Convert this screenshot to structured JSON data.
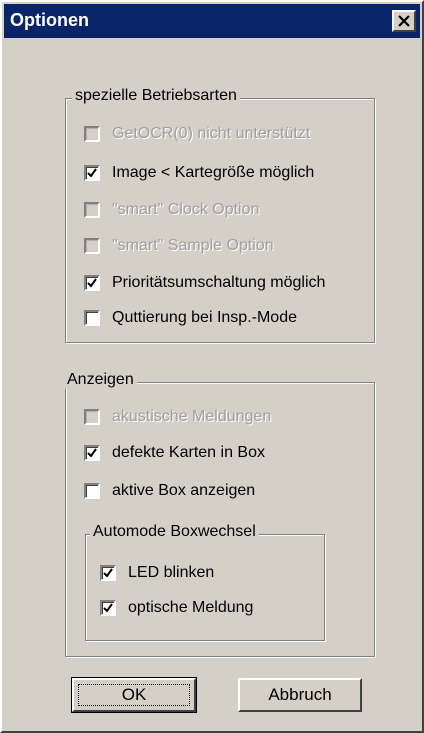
{
  "window": {
    "title": "Optionen",
    "close_label": "×"
  },
  "group_betrieb": {
    "label": "spezielle Betriebsarten",
    "items": [
      {
        "label": "GetOCR(0) nicht unterstützt",
        "checked": false,
        "enabled": false
      },
      {
        "label": "Image < Kartegröße möglich",
        "checked": true,
        "enabled": true
      },
      {
        "label": "\"smart\" Clock Option",
        "checked": false,
        "enabled": false
      },
      {
        "label": "\"smart\" Sample Option",
        "checked": false,
        "enabled": false
      },
      {
        "label": "Prioritätsumschaltung möglich",
        "checked": true,
        "enabled": true
      },
      {
        "label": "Quttierung bei Insp.-Mode",
        "checked": false,
        "enabled": true
      }
    ]
  },
  "group_anzeigen": {
    "label": "Anzeigen",
    "items": [
      {
        "label": "akustische Meldungen",
        "checked": false,
        "enabled": false
      },
      {
        "label": "defekte Karten in Box",
        "checked": true,
        "enabled": true
      },
      {
        "label": "aktive Box anzeigen",
        "checked": false,
        "enabled": true
      }
    ]
  },
  "group_automode": {
    "label": "Automode Boxwechsel",
    "items": [
      {
        "label": "LED blinken",
        "checked": true,
        "enabled": true
      },
      {
        "label": "optische Meldung",
        "checked": true,
        "enabled": true
      }
    ]
  },
  "buttons": {
    "ok": "OK",
    "cancel": "Abbruch"
  }
}
